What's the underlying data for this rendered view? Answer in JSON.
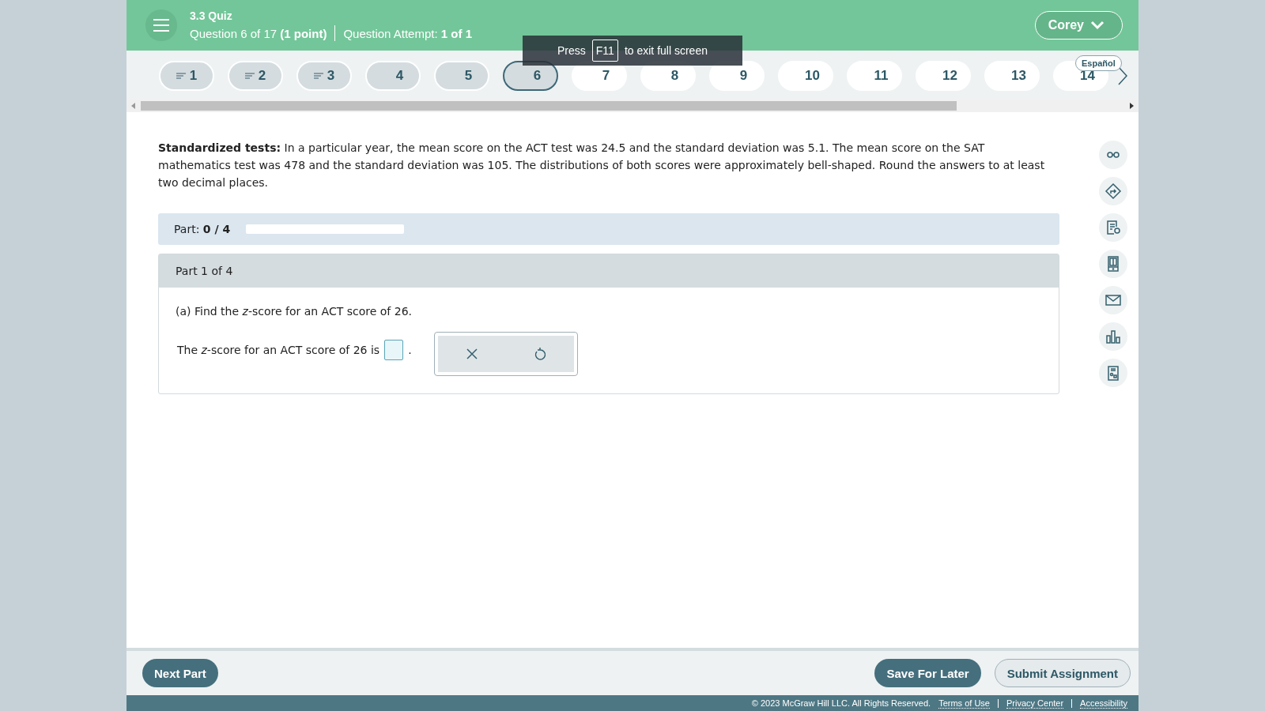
{
  "header": {
    "quiz_title": "3.3 Quiz",
    "question_info": "Question 6 of 17",
    "points": "(1 point)",
    "attempt_label": "Question Attempt:",
    "attempt_value": "1 of 1",
    "user_menu": "Corey"
  },
  "question_nav": [
    {
      "label": "1",
      "visited": true,
      "has_work": true,
      "selected": false
    },
    {
      "label": "2",
      "visited": true,
      "has_work": true,
      "selected": false
    },
    {
      "label": "3",
      "visited": true,
      "has_work": true,
      "selected": false
    },
    {
      "label": "4",
      "visited": true,
      "has_work": false,
      "selected": false
    },
    {
      "label": "5",
      "visited": true,
      "has_work": false,
      "selected": false
    },
    {
      "label": "6",
      "visited": true,
      "has_work": false,
      "selected": true
    },
    {
      "label": "7",
      "visited": false,
      "has_work": false,
      "selected": false
    },
    {
      "label": "8",
      "visited": false,
      "has_work": false,
      "selected": false
    },
    {
      "label": "9",
      "visited": false,
      "has_work": false,
      "selected": false
    },
    {
      "label": "10",
      "visited": false,
      "has_work": false,
      "selected": false
    },
    {
      "label": "11",
      "visited": false,
      "has_work": false,
      "selected": false
    },
    {
      "label": "12",
      "visited": false,
      "has_work": false,
      "selected": false
    },
    {
      "label": "13",
      "visited": false,
      "has_work": false,
      "selected": false
    },
    {
      "label": "14",
      "visited": false,
      "has_work": false,
      "selected": false
    }
  ],
  "language_badge": "Español",
  "fullscreen_notice": {
    "before": "Press",
    "key": "F11",
    "after": "to exit full screen"
  },
  "problem": "**Standardized tests:** In a particular year, the mean score on the ACT test was 24.5 and the standard deviation was 5.1. The mean score on the SAT mathematics test was 478 and the standard deviation was 105. The distributions of both scores were approximately bell-shaped. Round the answers to at least two decimal places.",
  "progress": {
    "label": "Part:",
    "value": "0 / 4",
    "level": 0
  },
  "part": {
    "title": "Part 1 of 4",
    "question": "(a) Find the *z*-score for an ACT score of 26.",
    "answer_before": "The *z*-score for an ACT score of 26 is",
    "answer_after": "."
  },
  "footer": {
    "next_part": "Next Part",
    "save": "Save For Later",
    "submit": "Submit Assignment",
    "copyright": "© 2023 McGraw Hill LLC. All Rights Reserved.",
    "links": [
      "Terms of Use",
      "Privacy Center",
      "Accessibility"
    ]
  }
}
